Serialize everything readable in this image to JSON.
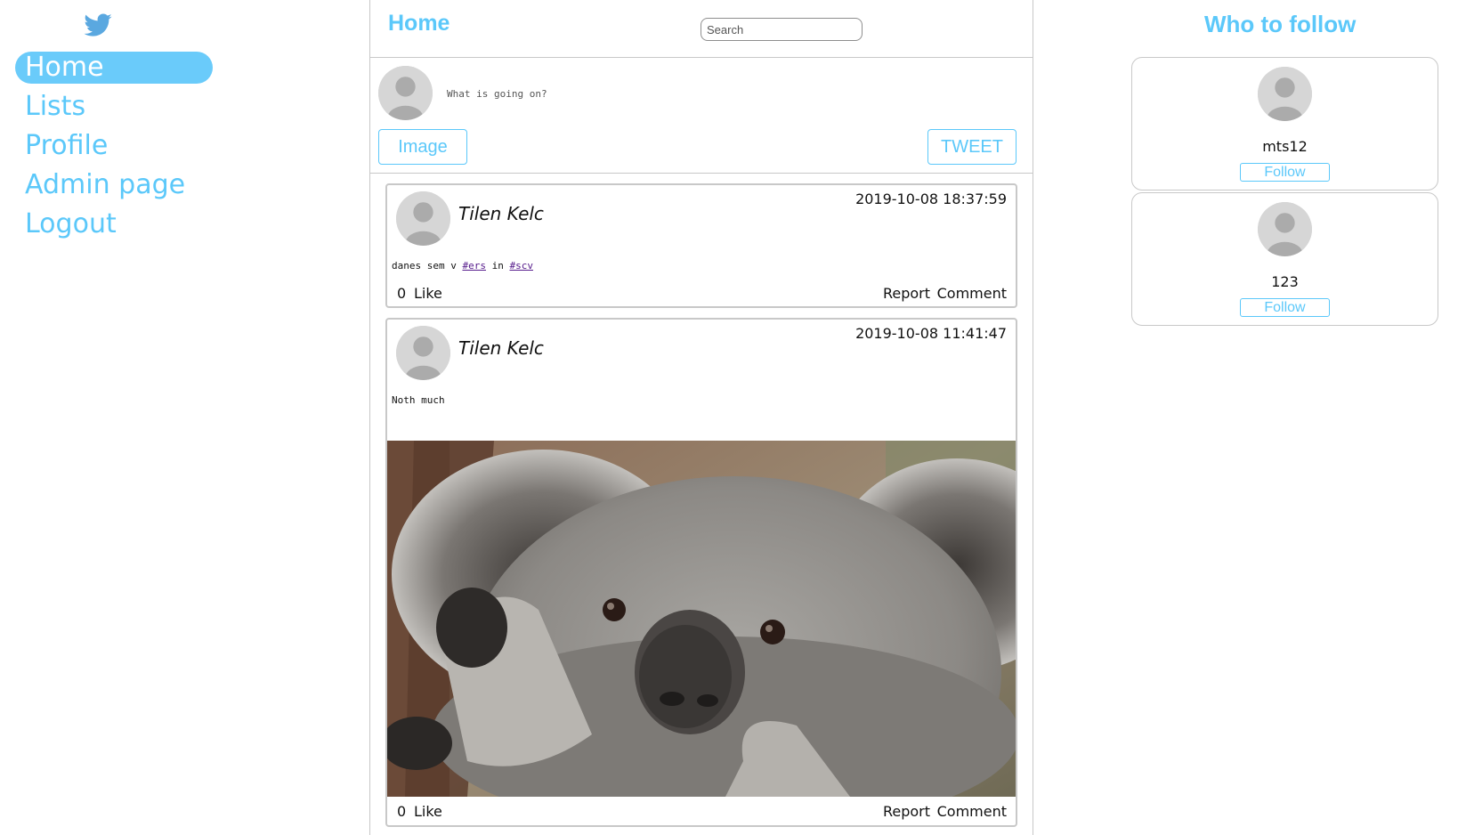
{
  "brand": {
    "logo_icon": "twitter-bird-icon",
    "accent_color": "#5bc8fa"
  },
  "sidebar": {
    "items": [
      {
        "label": "Home",
        "active": true
      },
      {
        "label": "Lists",
        "active": false
      },
      {
        "label": "Profile",
        "active": false
      },
      {
        "label": "Admin page",
        "active": false
      },
      {
        "label": "Logout",
        "active": false
      }
    ]
  },
  "header": {
    "title": "Home",
    "search_placeholder": "Search"
  },
  "compose": {
    "placeholder": "What is going on?",
    "image_label": "Image",
    "tweet_label": "TWEET"
  },
  "tweets": [
    {
      "author": "Tilen Kelc",
      "timestamp": "2019-10-08 18:37:59",
      "text_prefix": "danes sem v ",
      "hashtag1": "#ers",
      "text_middle": " in ",
      "hashtag2": "#scv",
      "likes": "0",
      "like_label": "Like",
      "report_label": "Report",
      "comment_label": "Comment"
    },
    {
      "author": "Tilen Kelc",
      "timestamp": "2019-10-08 11:41:47",
      "text": "Noth much",
      "image": "koala-photo",
      "likes": "0",
      "like_label": "Like",
      "report_label": "Report",
      "comment_label": "Comment"
    }
  ],
  "who_to_follow": {
    "title": "Who to follow",
    "users": [
      {
        "name": "mts12",
        "button_label": "Follow"
      },
      {
        "name": "123",
        "button_label": "Follow"
      }
    ]
  }
}
